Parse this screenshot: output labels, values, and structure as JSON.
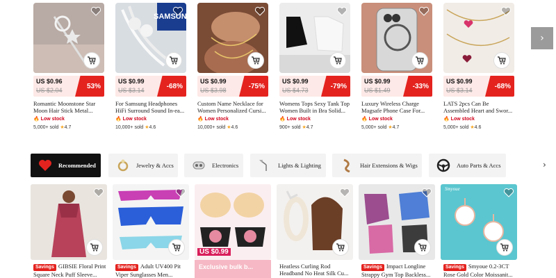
{
  "products": [
    {
      "title": "Romantic Moonstone Star Moon Hair Stick Metal...",
      "price": "US $0.96",
      "old_price": "US $2.04",
      "discount": "53%",
      "stock": "Low stock",
      "sold": "5,000+ sold",
      "rating": "4.7"
    },
    {
      "title": "For Samsung Headphones HiFi Surround Sound In-ea...",
      "price": "US $0.99",
      "old_price": "US $3.14",
      "discount": "-68%",
      "stock": "Low stock",
      "sold": "10,000+ sold",
      "rating": "4.6",
      "brand_text": "SAMSUNG"
    },
    {
      "title": "Custom Name Necklace for Women Personalized Cursi...",
      "price": "US $0.99",
      "old_price": "US $3.98",
      "discount": "-75%",
      "stock": "Low stock",
      "sold": "10,000+ sold",
      "rating": "4.6"
    },
    {
      "title": "Womens Tops Sexy Tank Top Women Built in Bra Solid...",
      "price": "US $0.99",
      "old_price": "US $4.73",
      "discount": "-79%",
      "stock": "Low stock",
      "sold": "900+ sold",
      "rating": "4.7"
    },
    {
      "title": "Luxury Wireless Charge Magsafe Phone Case For...",
      "price": "US $0.99",
      "old_price": "US $1.49",
      "discount": "-33%",
      "stock": "Low stock",
      "sold": "5,000+ sold",
      "rating": "4.7"
    },
    {
      "title": "LATS 2pcs Can Be Assembled Heart and Swor...",
      "price": "US $0.99",
      "old_price": "US $3.14",
      "discount": "-68%",
      "stock": "Low stock",
      "sold": "5,000+ sold",
      "rating": "4.6"
    }
  ],
  "categories": [
    {
      "label": "Recommended",
      "icon": "heart-icon"
    },
    {
      "label": "Jewelry & Accs",
      "icon": "ring-icon"
    },
    {
      "label": "Electronics",
      "icon": "earbuds-icon"
    },
    {
      "label": "Lights & Lighting",
      "icon": "lamp-icon"
    },
    {
      "label": "Hair Extensions & Wigs",
      "icon": "hair-icon"
    },
    {
      "label": "Auto Parts & Accs",
      "icon": "steering-wheel-icon"
    }
  ],
  "recommended": [
    {
      "badge": "Savings",
      "title": "GIBSIE Floral Print Square Neck Puff Sleeve..."
    },
    {
      "badge": "Savings",
      "title": "Adult UV400 Pit Viper Sunglasses Men..."
    },
    {
      "badge": "",
      "title": "Exclusive bulk b...",
      "price_overlay": "US $0.99"
    },
    {
      "badge": "",
      "title": "Heatless Curling Rod Headband No Heat Silk Cu..."
    },
    {
      "badge": "Savings",
      "title": "Impact Longline Strappy Gym Top Backless..."
    },
    {
      "badge": "Savings",
      "title": "Smyoue 0.2-3CT Rose Gold Color Moissanit...",
      "brand_text": "Smyoue"
    }
  ],
  "colors": {
    "accent": "#e4231f",
    "price_bg": "#fde9e7"
  }
}
